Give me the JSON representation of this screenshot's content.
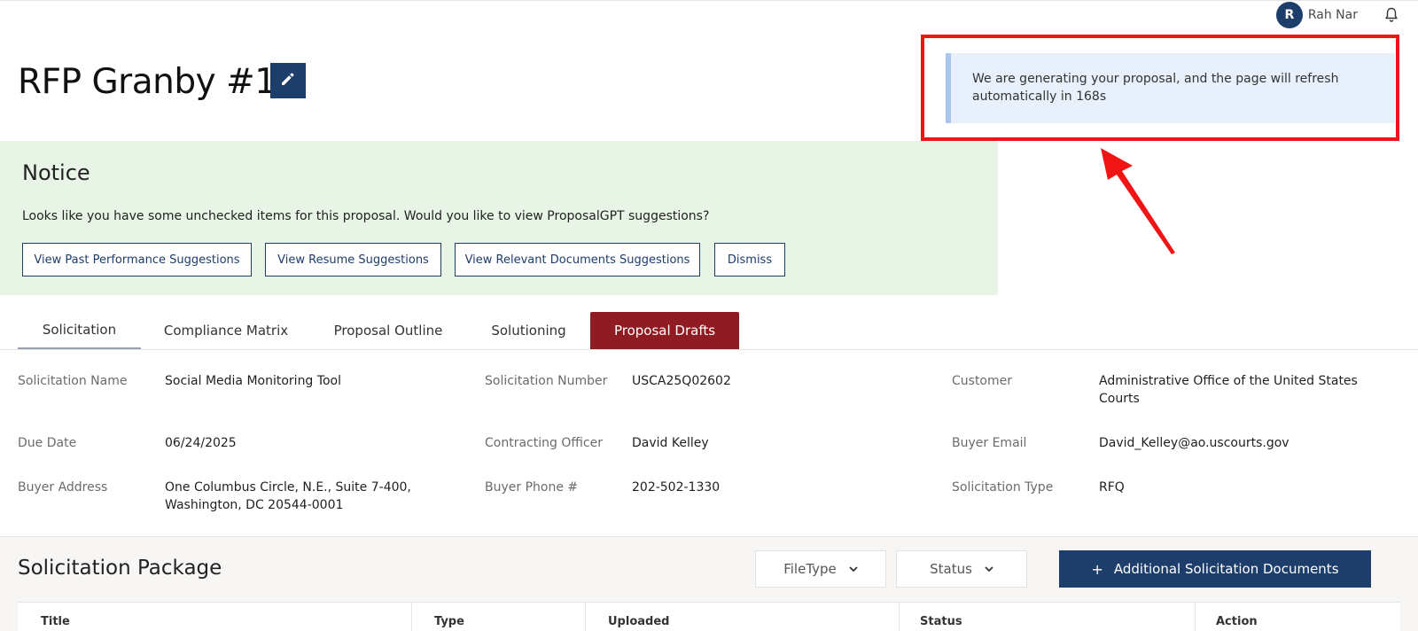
{
  "user": {
    "initial": "R",
    "name": "Rah Nar"
  },
  "page": {
    "title": "RFP Granby #1"
  },
  "alert": {
    "message": "We are generating your proposal, and the page will refresh automatically in 168s"
  },
  "notice": {
    "title": "Notice",
    "text": "Looks like you have some unchecked items for this proposal. Would you like to view ProposalGPT suggestions?",
    "buttons": [
      "View Past Performance Suggestions",
      "View Resume Suggestions",
      "View Relevant Documents Suggestions",
      "Dismiss"
    ]
  },
  "tabs": [
    "Solicitation",
    "Compliance Matrix",
    "Proposal Outline",
    "Solutioning",
    "Proposal Drafts"
  ],
  "details": {
    "solicitation_name": {
      "label": "Solicitation Name",
      "value": "Social Media Monitoring Tool"
    },
    "solicitation_number": {
      "label": "Solicitation Number",
      "value": "USCA25Q02602"
    },
    "customer": {
      "label": "Customer",
      "value": "Administrative Office of the United States Courts"
    },
    "due_date": {
      "label": "Due Date",
      "value": "06/24/2025"
    },
    "contracting_officer": {
      "label": "Contracting Officer",
      "value": "David Kelley"
    },
    "buyer_email": {
      "label": "Buyer Email",
      "value": "David_Kelley@ao.uscourts.gov"
    },
    "buyer_address": {
      "label": "Buyer Address",
      "value": "One Columbus Circle, N.E., Suite 7-400, Washington, DC 20544-0001"
    },
    "buyer_phone": {
      "label": "Buyer Phone #",
      "value": "202-502-1330"
    },
    "solicitation_type": {
      "label": "Solicitation Type",
      "value": "RFQ"
    }
  },
  "package": {
    "title": "Solicitation Package",
    "filters": [
      "FileType",
      "Status"
    ],
    "add_button": "Additional Solicitation Documents",
    "columns": [
      "Title",
      "Type",
      "Uploaded",
      "Status",
      "Action"
    ]
  },
  "colors": {
    "brand_navy": "#1d3d6b",
    "active_tab": "#8e1c22",
    "notice_bg": "#e8f5e6",
    "alert_bg": "#e7f0fb",
    "highlight_red": "#f01414"
  }
}
